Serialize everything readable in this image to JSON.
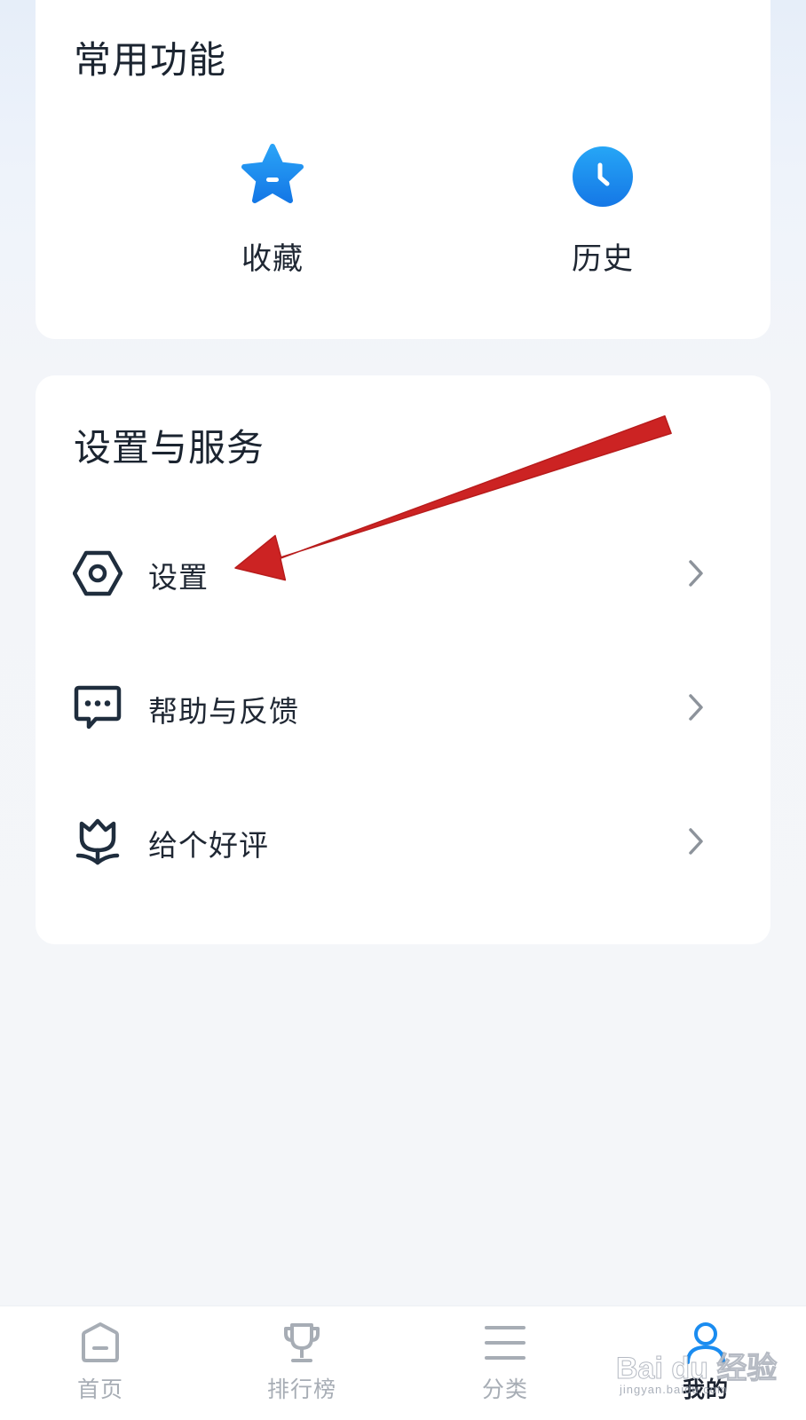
{
  "quick_functions": {
    "title": "常用功能",
    "items": [
      {
        "label": "收藏",
        "icon": "star-icon"
      },
      {
        "label": "历史",
        "icon": "clock-icon"
      }
    ]
  },
  "settings_services": {
    "title": "设置与服务",
    "items": [
      {
        "label": "设置",
        "icon": "settings-hexagon-icon"
      },
      {
        "label": "帮助与反馈",
        "icon": "chat-bubble-icon"
      },
      {
        "label": "给个好评",
        "icon": "tulip-icon"
      }
    ]
  },
  "tabbar": {
    "items": [
      {
        "label": "首页",
        "icon": "home-icon"
      },
      {
        "label": "排行榜",
        "icon": "trophy-icon"
      },
      {
        "label": "分类",
        "icon": "menu-lines-icon"
      },
      {
        "label": "我的",
        "icon": "user-icon",
        "active": true
      }
    ]
  },
  "watermark": {
    "brand": "Bai du 经验",
    "url": "jingyan.baidu.com"
  },
  "colors": {
    "accent_blue": "#1a8cf0",
    "annotation_red": "#cc2323",
    "icon_dark": "#1f2d3d",
    "tab_inactive": "#a7adb5"
  }
}
